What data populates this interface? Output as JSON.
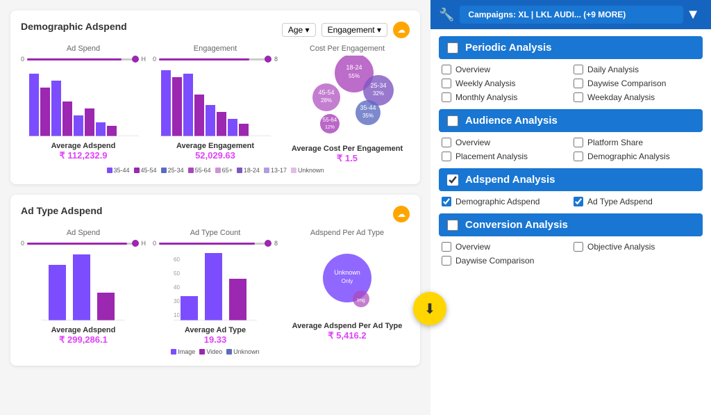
{
  "header": {
    "campaigns_label": "Campaigns:  XL | LKL AUDI... (+9 MORE)",
    "wrench": "🔧",
    "filter": "▼"
  },
  "left": {
    "card1": {
      "title": "Demographic Adspend",
      "controls": [
        "Age ▾",
        "Engagement ▾"
      ],
      "sections": [
        {
          "label": "Ad Spend",
          "avg_label": "Average Adspend",
          "avg_value": "₹ 112,232.9"
        },
        {
          "label": "Engagement",
          "avg_label": "Average Engagement",
          "avg_value": "52,029.63"
        },
        {
          "label": "Cost Per Engagement",
          "avg_label": "Average Cost Per Engagement",
          "avg_value": "₹ 1.5"
        }
      ],
      "legend": [
        "35-44",
        "45-54",
        "25-34",
        "55-64",
        "65+",
        "18-24",
        "13-17",
        "Unknown"
      ]
    },
    "card2": {
      "title": "Ad Type Adspend",
      "sections": [
        {
          "label": "Ad Spend",
          "avg_label": "Average Adspend",
          "avg_value": "₹ 299,286.1"
        },
        {
          "label": "Ad Type Count",
          "avg_label": "Average Ad Type",
          "avg_value": "19.33"
        },
        {
          "label": "Adspend Per Ad Type",
          "avg_label": "Average Adspend Per Ad Type",
          "avg_value": "₹ 5,416.2"
        }
      ],
      "legend": [
        "Image",
        "Video",
        "Unknown"
      ]
    }
  },
  "right": {
    "sections": [
      {
        "id": "periodic",
        "label": "Periodic Analysis",
        "checked": false,
        "options": [
          {
            "label": "Overview",
            "checked": false
          },
          {
            "label": "Daily Analysis",
            "checked": false
          },
          {
            "label": "Weekly Analysis",
            "checked": false
          },
          {
            "label": "Daywise Comparison",
            "checked": false
          },
          {
            "label": "Monthly Analysis",
            "checked": false
          },
          {
            "label": "Weekday Analysis",
            "checked": false
          }
        ]
      },
      {
        "id": "audience",
        "label": "Audience Analysis",
        "checked": false,
        "options": [
          {
            "label": "Overview",
            "checked": false
          },
          {
            "label": "Platform Share",
            "checked": false
          },
          {
            "label": "Placement Analysis",
            "checked": false
          },
          {
            "label": "Demographic Analysis",
            "checked": false
          }
        ]
      },
      {
        "id": "adspend",
        "label": "Adspend Analysis",
        "checked": true,
        "options": [
          {
            "label": "Demographic Adspend",
            "checked": true
          },
          {
            "label": "Ad Type Adspend",
            "checked": true
          }
        ]
      },
      {
        "id": "conversion",
        "label": "Conversion Analysis",
        "checked": false,
        "options": [
          {
            "label": "Overview",
            "checked": false
          },
          {
            "label": "Objective Analysis",
            "checked": false
          },
          {
            "label": "Daywise Comparison",
            "checked": false
          }
        ]
      }
    ]
  }
}
